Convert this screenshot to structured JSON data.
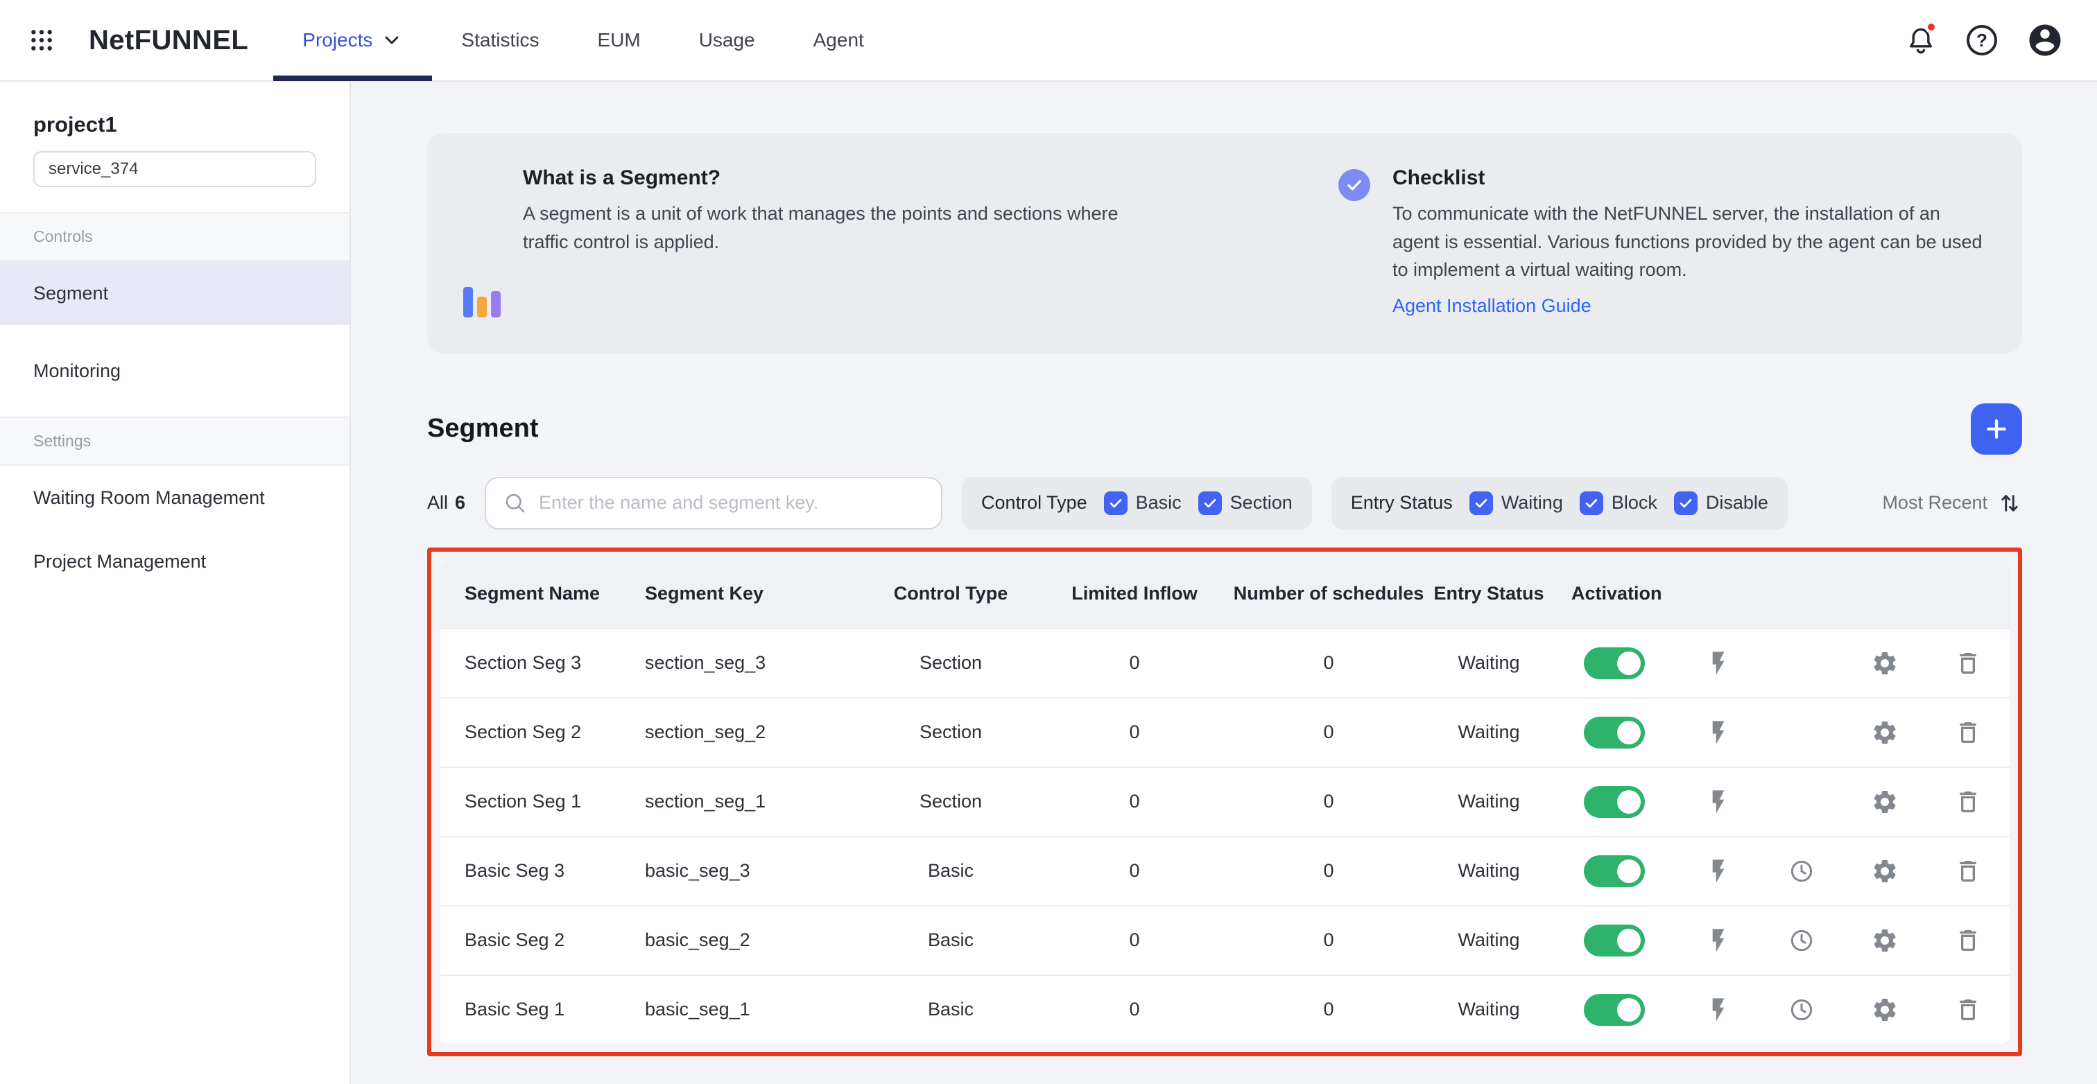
{
  "topnav": {
    "logo": "NetFUNNEL",
    "items": [
      {
        "label": "Projects"
      },
      {
        "label": "Statistics"
      },
      {
        "label": "EUM"
      },
      {
        "label": "Usage"
      },
      {
        "label": "Agent"
      }
    ]
  },
  "sidebar": {
    "project": "project1",
    "service": "service_374",
    "controls_label": "Controls",
    "settings_label": "Settings",
    "items": {
      "segment": "Segment",
      "monitoring": "Monitoring",
      "waiting_room": "Waiting Room Management",
      "project_mgmt": "Project Management"
    }
  },
  "banner": {
    "segment_info": {
      "title": "What is a Segment?",
      "body": "A segment is a unit of work that manages the points and sections where traffic control is applied."
    },
    "checklist": {
      "title": "Checklist",
      "body": "To communicate with the NetFUNNEL server, the installation of an agent is essential. Various functions provided by the agent can be used to implement a virtual waiting room.",
      "link": "Agent Installation Guide"
    }
  },
  "segment": {
    "title": "Segment",
    "all_label": "All",
    "count": "6",
    "search_placeholder": "Enter the name and segment key.",
    "control_type": {
      "label": "Control Type",
      "options": [
        "Basic",
        "Section"
      ]
    },
    "entry_status": {
      "label": "Entry Status",
      "options": [
        "Waiting",
        "Block",
        "Disable"
      ]
    },
    "sort": "Most Recent"
  },
  "table": {
    "columns": [
      "Segment Name",
      "Segment Key",
      "Control Type",
      "Limited Inflow",
      "Number of schedules",
      "Entry Status",
      "Activation"
    ],
    "rows": [
      {
        "name": "Section Seg 3",
        "key": "section_seg_3",
        "type": "Section",
        "inflow": "0",
        "schedules": "0",
        "status": "Waiting",
        "active": true
      },
      {
        "name": "Section Seg 2",
        "key": "section_seg_2",
        "type": "Section",
        "inflow": "0",
        "schedules": "0",
        "status": "Waiting",
        "active": true
      },
      {
        "name": "Section Seg 1",
        "key": "section_seg_1",
        "type": "Section",
        "inflow": "0",
        "schedules": "0",
        "status": "Waiting",
        "active": true
      },
      {
        "name": "Basic Seg 3",
        "key": "basic_seg_3",
        "type": "Basic",
        "inflow": "0",
        "schedules": "0",
        "status": "Waiting",
        "active": true
      },
      {
        "name": "Basic Seg 2",
        "key": "basic_seg_2",
        "type": "Basic",
        "inflow": "0",
        "schedules": "0",
        "status": "Waiting",
        "active": true
      },
      {
        "name": "Basic Seg 1",
        "key": "basic_seg_1",
        "type": "Basic",
        "inflow": "0",
        "schedules": "0",
        "status": "Waiting",
        "active": true
      }
    ]
  },
  "colors": {
    "accent_blue": "#3e63f0",
    "checkbox_blue": "#4262f0",
    "toggle_green": "#2fb26b",
    "annotation_red": "#e83a20",
    "link_blue": "#2d66f4",
    "active_nav_blue": "#3b4fd8"
  }
}
